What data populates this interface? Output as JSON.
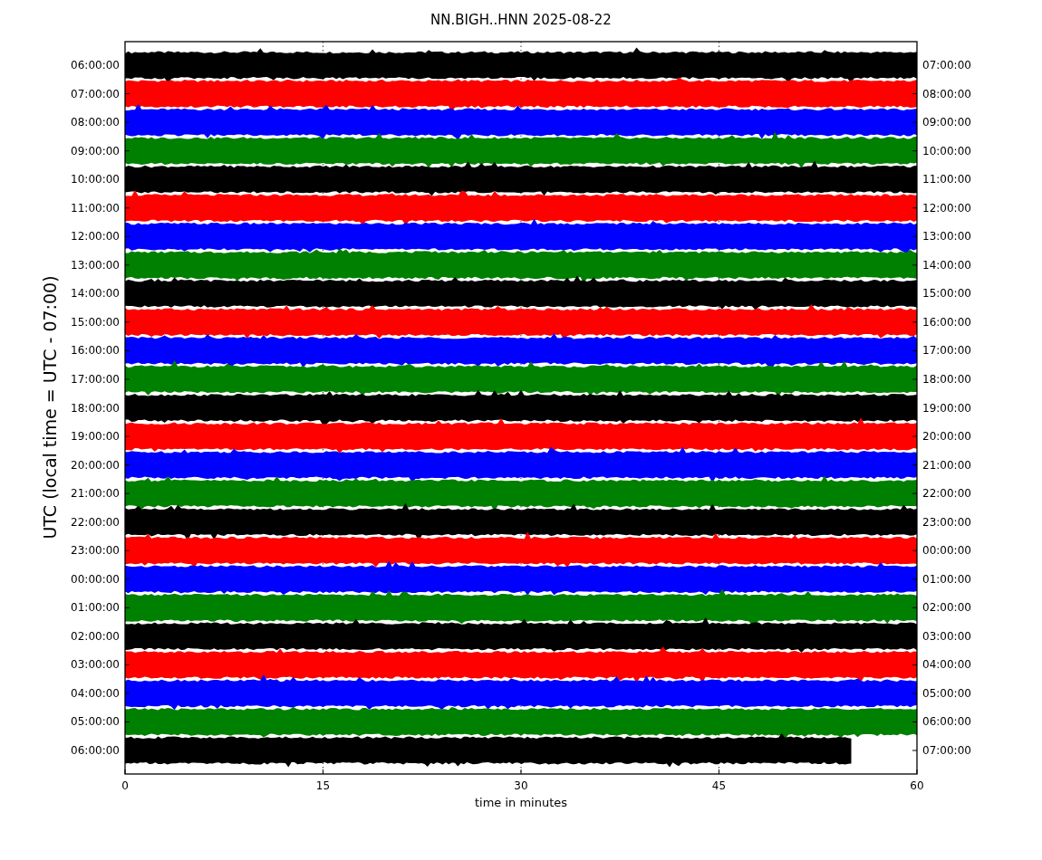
{
  "title": "NN.BIGH..HNN 2025-08-22",
  "ylabel": "UTC (local time = UTC - 07:00)",
  "xlabel": "time in minutes",
  "xticks": [
    "0",
    "15",
    "30",
    "45",
    "60"
  ],
  "rows": [
    {
      "left": "06:00:00",
      "right": "07:00:00",
      "color": "#000000",
      "level": 1
    },
    {
      "left": "07:00:00",
      "right": "08:00:00",
      "color": "#ff0000",
      "level": 1
    },
    {
      "left": "08:00:00",
      "right": "09:00:00",
      "color": "#0000ff",
      "level": 1
    },
    {
      "left": "09:00:00",
      "right": "10:00:00",
      "color": "#008000",
      "level": 1
    },
    {
      "left": "10:00:00",
      "right": "11:00:00",
      "color": "#000000",
      "level": 1
    },
    {
      "left": "11:00:00",
      "right": "12:00:00",
      "color": "#ff0000",
      "level": 1
    },
    {
      "left": "12:00:00",
      "right": "13:00:00",
      "color": "#0000ff",
      "level": 1
    },
    {
      "left": "13:00:00",
      "right": "14:00:00",
      "color": "#008000",
      "level": 1
    },
    {
      "left": "14:00:00",
      "right": "15:00:00",
      "color": "#000000",
      "level": 1
    },
    {
      "left": "15:00:00",
      "right": "16:00:00",
      "color": "#ff0000",
      "level": 1
    },
    {
      "left": "16:00:00",
      "right": "17:00:00",
      "color": "#0000ff",
      "level": 1
    },
    {
      "left": "17:00:00",
      "right": "18:00:00",
      "color": "#008000",
      "level": 1
    },
    {
      "left": "18:00:00",
      "right": "19:00:00",
      "color": "#000000",
      "level": 1
    },
    {
      "left": "19:00:00",
      "right": "20:00:00",
      "color": "#ff0000",
      "level": 1
    },
    {
      "left": "20:00:00",
      "right": "21:00:00",
      "color": "#0000ff",
      "level": 1
    },
    {
      "left": "21:00:00",
      "right": "22:00:00",
      "color": "#008000",
      "level": 1
    },
    {
      "left": "22:00:00",
      "right": "23:00:00",
      "color": "#000000",
      "level": 1
    },
    {
      "left": "23:00:00",
      "right": "00:00:00",
      "color": "#ff0000",
      "level": 1
    },
    {
      "left": "00:00:00",
      "right": "01:00:00",
      "color": "#0000ff",
      "level": 1
    },
    {
      "left": "01:00:00",
      "right": "02:00:00",
      "color": "#008000",
      "level": 1
    },
    {
      "left": "02:00:00",
      "right": "03:00:00",
      "color": "#000000",
      "level": 1
    },
    {
      "left": "03:00:00",
      "right": "04:00:00",
      "color": "#ff0000",
      "level": 1
    },
    {
      "left": "04:00:00",
      "right": "05:00:00",
      "color": "#0000ff",
      "level": 1
    },
    {
      "left": "05:00:00",
      "right": "06:00:00",
      "color": "#008000",
      "level": 1
    },
    {
      "left": "06:00:00",
      "right": "07:00:00",
      "color": "#000000",
      "level": 0.917
    }
  ]
}
